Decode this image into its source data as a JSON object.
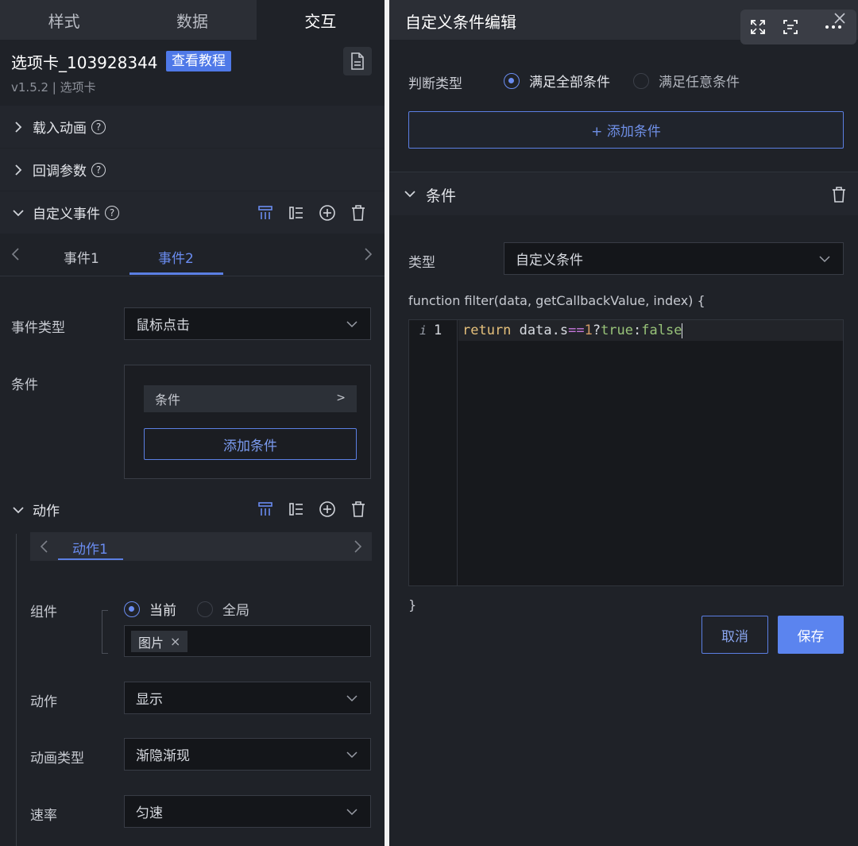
{
  "left": {
    "tabs": [
      "样式",
      "数据",
      "交互"
    ],
    "component": {
      "title": "选项卡_103928344",
      "tutorial_badge": "查看教程",
      "version": "v1.5.2 | 选项卡"
    },
    "sections": {
      "load_animation": "载入动画",
      "callback_params": "回调参数",
      "custom_events": "自定义事件"
    },
    "event_tabs": [
      "事件1",
      "事件2"
    ],
    "event_type": {
      "label": "事件类型",
      "value": "鼠标点击"
    },
    "condition": {
      "label": "条件",
      "item": "条件",
      "item_arrow": ">",
      "add_button": "添加条件"
    },
    "actions": {
      "header": "动作",
      "tab": "动作1",
      "component": {
        "label": "组件",
        "option_current": "当前",
        "option_global": "全局",
        "tag": "图片",
        "tag_close": "×"
      },
      "action": {
        "label": "动作",
        "value": "显示"
      },
      "animation_type": {
        "label": "动画类型",
        "value": "渐隐渐现"
      },
      "rate": {
        "label": "速率",
        "value": "匀速"
      }
    }
  },
  "right": {
    "title": "自定义条件编辑",
    "judge": {
      "label": "判断类型",
      "option_all": "满足全部条件",
      "option_any": "满足任意条件"
    },
    "add_condition": "+ 添加条件",
    "condition_header": "条件",
    "type": {
      "label": "类型",
      "value": "自定义条件"
    },
    "code": {
      "signature": "function filter(data, getCallbackValue, index) {",
      "line_info": "i",
      "line_number": "1",
      "code_return": "return",
      "code_data": " data.s",
      "code_eq": "==",
      "code_one": "1",
      "code_q": "?",
      "code_true": "true",
      "code_colon": ":",
      "code_false": "false",
      "closing": "}"
    },
    "cancel": "取消",
    "save": "保存"
  },
  "colors": {
    "accent": "#5b7fe3",
    "panel_bg": "#1f2228",
    "input_bg": "#14161a",
    "save_bg": "#5b84ef"
  }
}
